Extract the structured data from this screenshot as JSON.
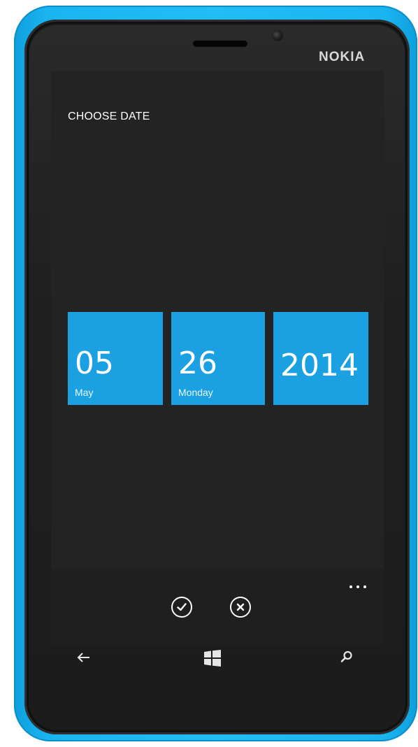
{
  "device": {
    "brand": "NOKIA",
    "colors": {
      "shell": "#1ab4f0",
      "bezel": "#1b1b1b",
      "screen": "#232323"
    }
  },
  "screen": {
    "title": "CHOOSE DATE",
    "accent_color": "#1ba1e2",
    "tiles": [
      {
        "value": "05",
        "sub": "May"
      },
      {
        "value": "26",
        "sub": "Monday"
      },
      {
        "value": "2014",
        "sub": ""
      }
    ]
  },
  "app_bar": {
    "buttons": [
      {
        "icon": "check-circle-icon",
        "action": "accept"
      },
      {
        "icon": "cancel-circle-icon",
        "action": "cancel"
      }
    ],
    "more_icon": "ellipsis-icon"
  },
  "hardware_buttons": [
    {
      "icon": "back-arrow-icon"
    },
    {
      "icon": "windows-start-icon"
    },
    {
      "icon": "search-icon"
    }
  ]
}
